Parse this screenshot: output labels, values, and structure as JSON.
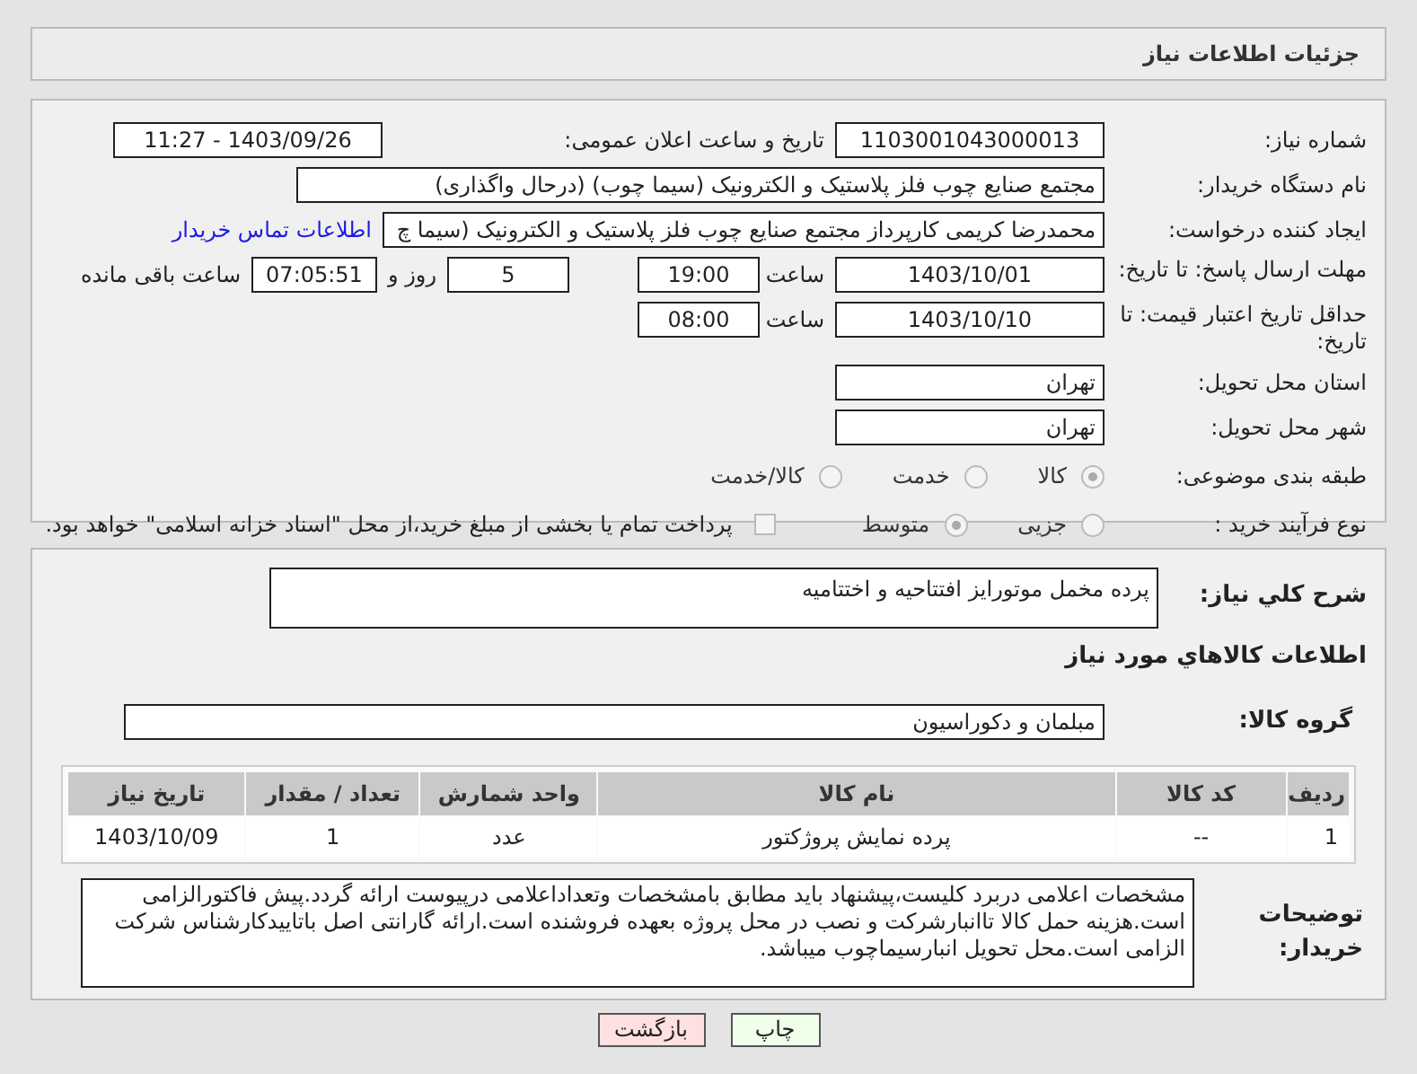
{
  "header": {
    "title": "جزئیات اطلاعات نیاز"
  },
  "need_number": {
    "label": "شماره نیاز:",
    "value": "1103001043000013"
  },
  "announce": {
    "label": "تاریخ و ساعت اعلان عمومی:",
    "value": "1403/09/26 - 11:27"
  },
  "buyer_org": {
    "label": "نام دستگاه خریدار:",
    "value": "مجتمع  صنایع چوب  فلز  پلاستیک و الکترونیک (سیما چوب) (درحال واگذاری)"
  },
  "requester": {
    "label": "ایجاد کننده درخواست:",
    "value": "محمدرضا کریمی کارپرداز مجتمع  صنایع چوب  فلز  پلاستیک و الکترونیک (سیما چ",
    "link": "اطلاعات تماس خریدار"
  },
  "response_deadline": {
    "label": "مهلت ارسال پاسخ: تا تاریخ:",
    "date": "1403/10/01",
    "time_label": "ساعت",
    "time": "19:00",
    "days": "5",
    "days_label": "روز و",
    "remaining": "07:05:51",
    "remaining_label": "ساعت باقی مانده"
  },
  "price_validity": {
    "label": "حداقل تاریخ اعتبار قیمت: تا تاریخ:",
    "date": "1403/10/10",
    "time_label": "ساعت",
    "time": "08:00"
  },
  "province": {
    "label": "استان محل تحویل:",
    "value": "تهران"
  },
  "city": {
    "label": "شهر محل تحویل:",
    "value": "تهران"
  },
  "category": {
    "label": "طبقه بندی موضوعی:",
    "options": [
      {
        "label": "کالا",
        "selected": true
      },
      {
        "label": "خدمت",
        "selected": false
      },
      {
        "label": "کالا/خدمت",
        "selected": false
      }
    ]
  },
  "purchase_type": {
    "label": "نوع فرآیند خرید :",
    "options": [
      {
        "label": "جزیی",
        "selected": false
      },
      {
        "label": "متوسط",
        "selected": true
      }
    ],
    "payment": {
      "label": "پرداخت تمام یا بخشی از مبلغ خرید،از محل \"اسناد خزانه اسلامی\" خواهد بود.",
      "checked": false
    }
  },
  "description": {
    "label": "شرح کلي نياز:",
    "value": "پرده مخمل موتورایز افتتاحیه و اختتامیه"
  },
  "goods_title": "اطلاعات کالاهاي مورد نياز",
  "goods_group": {
    "label": "گروه کالا:",
    "value": "مبلمان و دکوراسیون"
  },
  "table": {
    "columns": [
      "ردیف",
      "کد کالا",
      "نام کالا",
      "واحد شمارش",
      "تعداد / مقدار",
      "تاریخ نیاز"
    ],
    "rows": [
      [
        "1",
        "--",
        "پرده نمایش پروژکتور",
        "عدد",
        "1",
        "1403/10/09"
      ]
    ]
  },
  "buyer_notes": {
    "label": "توضیحات خریدار:",
    "value": "مشخصات اعلامی دربرد کلیست،پیشنهاد باید مطابق بامشخصات وتعداداعلامی درپیوست ارائه گردد.پیش فاکتورالزامی است.هزینه حمل کالا تاانبارشرکت و نصب در محل پروژه بعهده فروشنده است.ارائه گارانتی اصل باتاییدکارشناس شرکت الزامی است.محل تحویل انبارسیماچوب میباشد."
  },
  "buttons": [
    {
      "label": "چاپ",
      "kind": "print"
    },
    {
      "label": "بازگشت",
      "kind": "back"
    }
  ]
}
